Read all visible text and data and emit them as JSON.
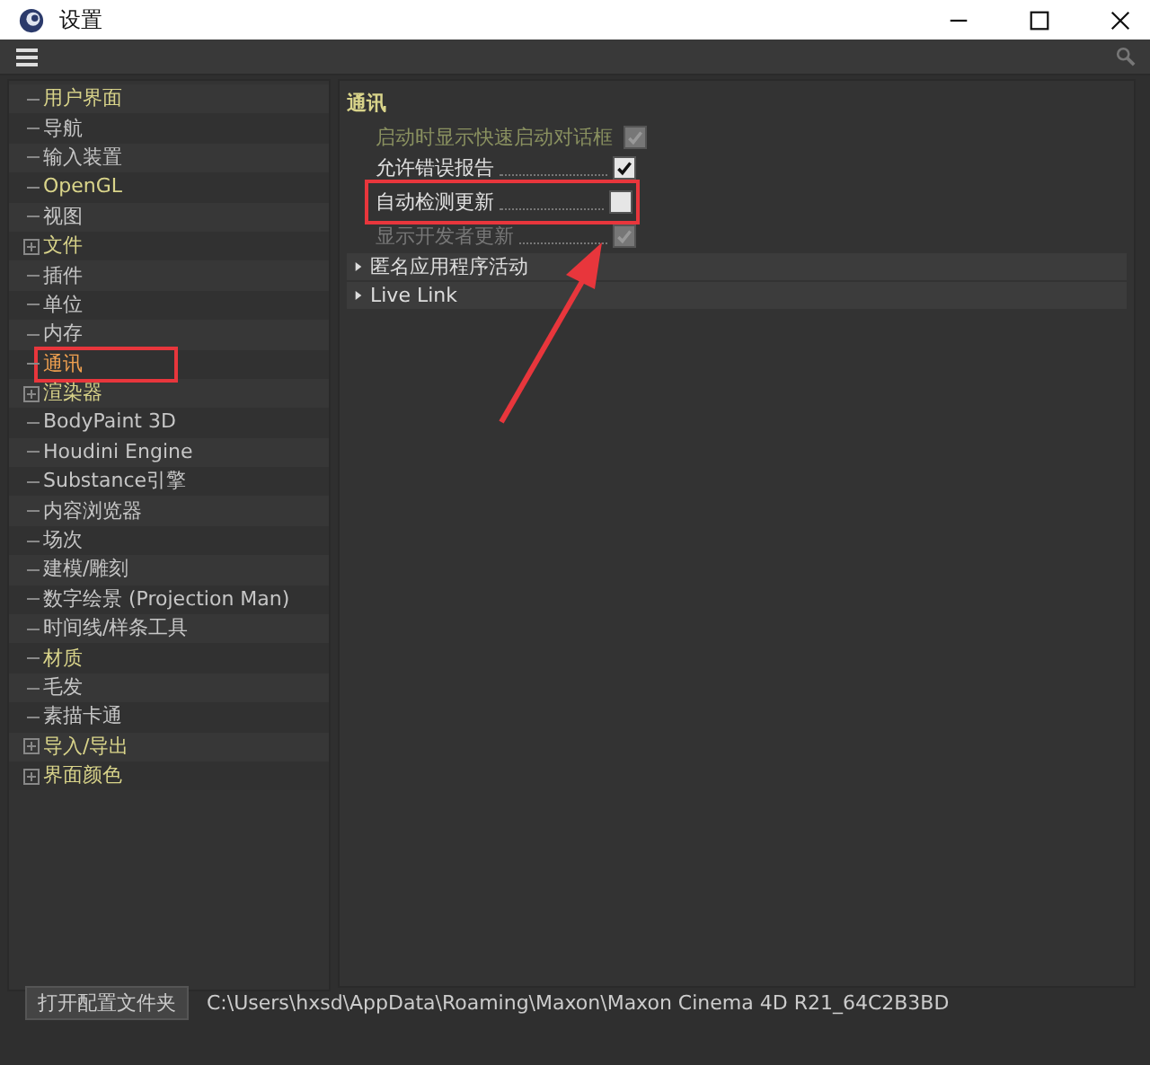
{
  "window": {
    "title": "设置"
  },
  "sidebar": {
    "items": [
      {
        "label": "用户界面",
        "accent": true,
        "selected": false,
        "annotated": false
      },
      {
        "label": "导航",
        "accent": false,
        "selected": false,
        "annotated": false
      },
      {
        "label": "输入装置",
        "accent": false,
        "selected": false,
        "annotated": false
      },
      {
        "label": "OpenGL",
        "accent": true,
        "selected": false,
        "annotated": false
      },
      {
        "label": "视图",
        "accent": false,
        "selected": false,
        "annotated": false
      },
      {
        "label": "文件",
        "accent": true,
        "selected": false,
        "expanded": false,
        "annotated": false
      },
      {
        "label": "插件",
        "accent": false,
        "selected": false,
        "annotated": false
      },
      {
        "label": "单位",
        "accent": false,
        "selected": false,
        "annotated": false
      },
      {
        "label": "内存",
        "accent": false,
        "selected": false,
        "annotated": false
      },
      {
        "label": "通讯",
        "accent": false,
        "selected": true,
        "annotated": true
      },
      {
        "label": "渲染器",
        "accent": true,
        "selected": false,
        "expanded": false,
        "annotated": false
      },
      {
        "label": "BodyPaint 3D",
        "accent": false,
        "selected": false,
        "annotated": false
      },
      {
        "label": "Houdini Engine",
        "accent": false,
        "selected": false,
        "annotated": false
      },
      {
        "label": "Substance引擎",
        "accent": false,
        "selected": false,
        "annotated": false
      },
      {
        "label": "内容浏览器",
        "accent": false,
        "selected": false,
        "annotated": false
      },
      {
        "label": "场次",
        "accent": false,
        "selected": false,
        "annotated": false
      },
      {
        "label": "建模/雕刻",
        "accent": false,
        "selected": false,
        "annotated": false
      },
      {
        "label": "数字绘景 (Projection Man)",
        "accent": false,
        "selected": false,
        "annotated": false
      },
      {
        "label": "时间线/样条工具",
        "accent": false,
        "selected": false,
        "annotated": false
      },
      {
        "label": "材质",
        "accent": true,
        "selected": false,
        "annotated": false
      },
      {
        "label": "毛发",
        "accent": false,
        "selected": false,
        "annotated": false
      },
      {
        "label": "素描卡通",
        "accent": false,
        "selected": false,
        "annotated": false
      },
      {
        "label": "导入/导出",
        "accent": true,
        "selected": false,
        "expanded": false,
        "annotated": false
      },
      {
        "label": "界面颜色",
        "accent": true,
        "selected": false,
        "expanded": false,
        "annotated": false
      }
    ]
  },
  "panel": {
    "heading": "通讯",
    "options": [
      {
        "label": "启动时显示快速启动对话框",
        "checked": true,
        "disabled": true,
        "annotated": false
      },
      {
        "label": "允许错误报告",
        "checked": true,
        "disabled": false,
        "annotated": false
      },
      {
        "label": "自动检测更新",
        "checked": false,
        "disabled": false,
        "annotated": true
      },
      {
        "label": "显示开发者更新",
        "checked": true,
        "disabled": true,
        "annotated": false
      }
    ],
    "sections": [
      {
        "label": "匿名应用程序活动",
        "expanded": false
      },
      {
        "label": "Live Link",
        "expanded": false
      }
    ]
  },
  "footer": {
    "button": "打开配置文件夹",
    "path": "C:\\Users\\hxsd\\AppData\\Roaming\\Maxon\\Maxon Cinema 4D R21_64C2B3BD"
  }
}
